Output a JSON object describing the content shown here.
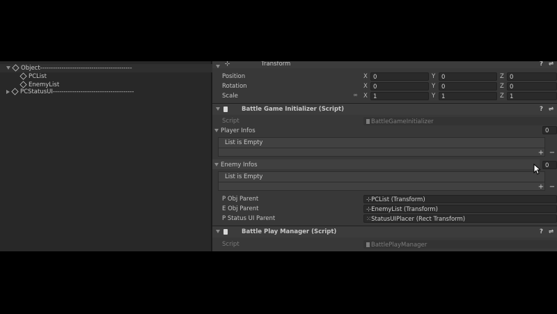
{
  "hierarchy": {
    "items": [
      {
        "label": "Object-------------------------------------------",
        "indent": 0,
        "expanded": true
      },
      {
        "label": "PCList",
        "indent": 1,
        "expanded": false
      },
      {
        "label": "EnemyList",
        "indent": 1,
        "expanded": false
      },
      {
        "label": "PCStatusUI--------------------------------------",
        "indent": 0,
        "expanded": false
      }
    ]
  },
  "transform": {
    "title": "Transform",
    "rows": [
      {
        "label": "Position",
        "x": "0",
        "y": "0",
        "z": "0"
      },
      {
        "label": "Rotation",
        "x": "0",
        "y": "0",
        "z": "0"
      },
      {
        "label": "Scale",
        "x": "1",
        "y": "1",
        "z": "1"
      }
    ],
    "axes": {
      "x": "X",
      "y": "Y",
      "z": "Z"
    }
  },
  "initializer": {
    "title": "Battle Game Initializer (Script)",
    "script_label": "Script",
    "script_value": "BattleGameInitializer",
    "player_infos": {
      "label": "Player Infos",
      "count": "0",
      "empty_text": "List is Empty"
    },
    "enemy_infos": {
      "label": "Enemy Infos",
      "count": "0",
      "empty_text": "List is Empty"
    },
    "p_obj_parent": {
      "label": "P Obj Parent",
      "value": "PCList (Transform)"
    },
    "e_obj_parent": {
      "label": "E Obj Parent",
      "value": "EnemyList (Transform)"
    },
    "p_status_ui_parent": {
      "label": "P Status UI Parent",
      "value": "StatusUIPlacer (Rect Transform)"
    }
  },
  "play_manager": {
    "title": "Battle Play Manager (Script)",
    "script_label": "Script",
    "script_value": "BattlePlayManager"
  },
  "buttons": {
    "add": "+",
    "remove": "−",
    "help": "?",
    "settings": "⇌"
  },
  "colors": {
    "editor_bg": "#282828",
    "inspector_bg": "#383838",
    "field_bg": "#2a2a2a"
  }
}
